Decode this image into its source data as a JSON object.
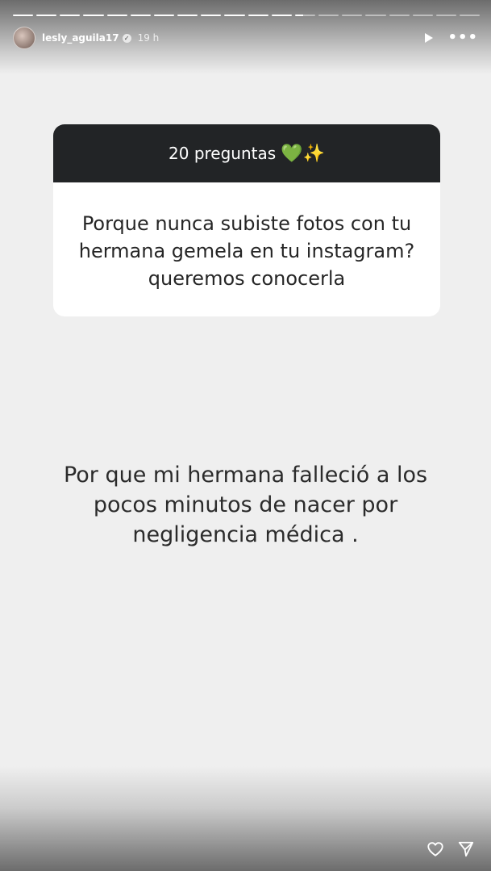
{
  "story": {
    "progress": {
      "segments": 20,
      "completed": 12,
      "active_fraction": 0.4
    },
    "user": {
      "username": "lesly_aguila17",
      "time": "19 h",
      "verified": true
    },
    "icons": {
      "play": "play-icon",
      "more": "more-icon",
      "like": "heart-icon",
      "share": "send-icon"
    }
  },
  "question_card": {
    "title": "20 preguntas",
    "title_emoji": "💚✨",
    "question": "Porque nunca subiste fotos con tu hermana gemela en tu instagram? queremos conocerla"
  },
  "answer": {
    "text": "Por que mi hermana falleció a los pocos minutos de nacer por negligencia médica ."
  },
  "colors": {
    "background": "#efefef",
    "card_header": "#222426",
    "card_body": "#ffffff"
  }
}
